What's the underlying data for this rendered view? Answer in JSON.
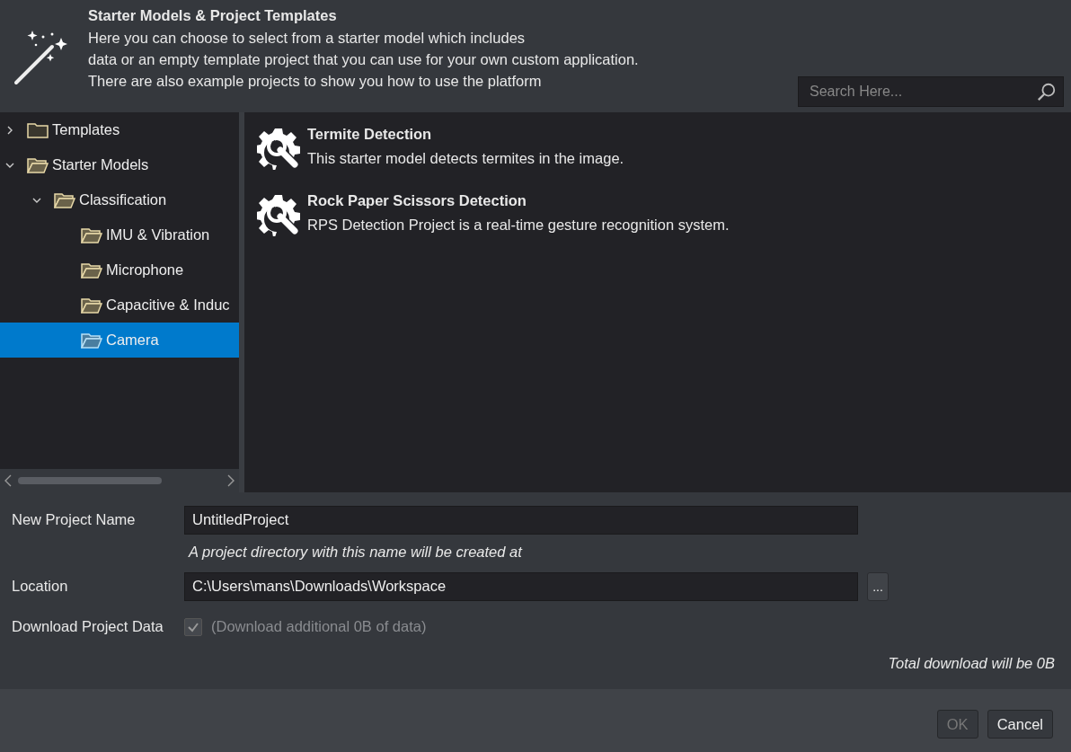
{
  "header": {
    "title": "Starter Models & Project Templates",
    "description_lines": [
      "Here you can choose to select from a starter model which includes",
      "data or an empty template project that you can use for your own custom application.",
      "There are also example projects to show you how to use the platform"
    ],
    "search": {
      "placeholder": "Search Here..."
    }
  },
  "tree": [
    {
      "label": "Templates",
      "expanded": false,
      "selected": false
    },
    {
      "label": "Starter Models",
      "expanded": true,
      "selected": false,
      "children": [
        {
          "label": "Classification",
          "expanded": true,
          "selected": false,
          "children": [
            {
              "label": "IMU & Vibration",
              "selected": false
            },
            {
              "label": "Microphone",
              "selected": false
            },
            {
              "label": "Capacitive & Induc",
              "selected": false
            },
            {
              "label": "Camera",
              "selected": true
            }
          ]
        }
      ]
    }
  ],
  "models": [
    {
      "title": "Termite Detection",
      "description": "This starter model detects termites in the image."
    },
    {
      "title": "Rock Paper Scissors Detection",
      "description": "RPS Detection Project is a real-time gesture recognition system."
    }
  ],
  "form": {
    "name_label": "New Project Name",
    "name_value": "UntitledProject",
    "hint": "A project directory with this name will be created at",
    "location_label": "Location",
    "location_value": "C:\\Users\\mans\\Downloads\\Workspace",
    "browse_label": "...",
    "download_label": "Download Project Data",
    "download": {
      "checked": true,
      "disabled": true
    },
    "download_note": "(Download additional 0B of data)",
    "total": "Total download will be 0B"
  },
  "buttons": [
    {
      "label": "OK",
      "disabled": true
    },
    {
      "label": "Cancel",
      "disabled": false
    }
  ]
}
